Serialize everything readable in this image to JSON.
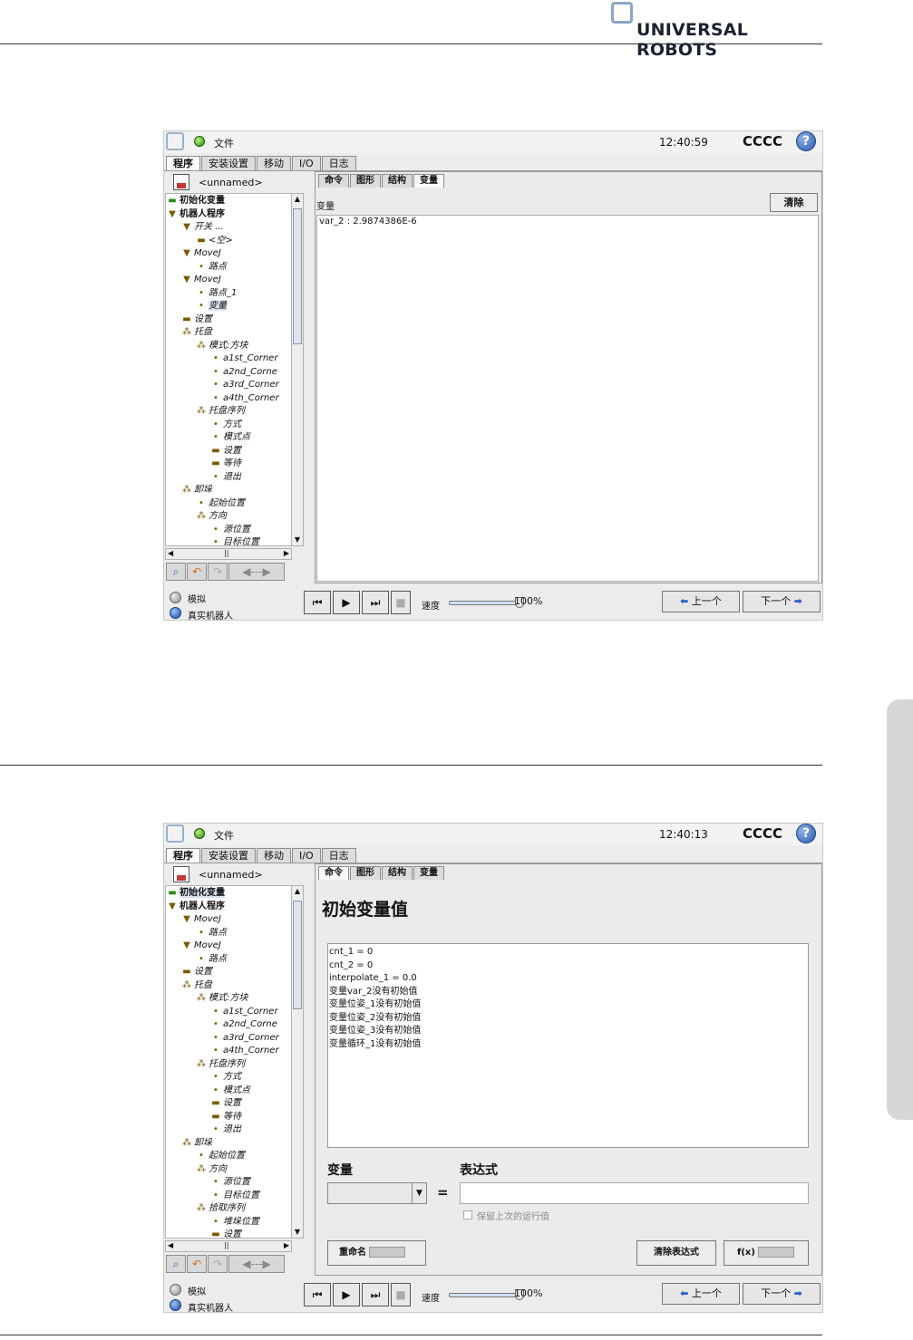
{
  "brand": {
    "logo_text": "UNIVERSAL ROBOTS"
  },
  "screens": [
    {
      "topbar": {
        "file_label": "文件",
        "time": "12:40:59",
        "robot_name": "CCCC",
        "help": "?"
      },
      "main_tabs": [
        "程序",
        "安装设置",
        "移动",
        "I/O",
        "日志"
      ],
      "program_name": "<unnamed>",
      "sub_tabs": [
        "命令",
        "图形",
        "结构",
        "变量"
      ],
      "active_sub_tab": "变量",
      "variables_panel": {
        "heading": "变量",
        "clear_button": "清除",
        "entries": [
          "var_2 : 2.9874386E-6"
        ]
      },
      "tree": [
        {
          "label": "初始化变量",
          "icon": "line-icon",
          "depth": 0
        },
        {
          "label": "机器人程序",
          "icon": "triangle-down-icon",
          "depth": 0
        },
        {
          "label": "开关 ...",
          "icon": "triangle-down-icon",
          "depth": 1
        },
        {
          "label": "<空>",
          "icon": "line-icon",
          "depth": 2
        },
        {
          "label": "MoveJ",
          "icon": "triangle-down-icon",
          "depth": 1
        },
        {
          "label": "路点",
          "icon": "dot-icon",
          "depth": 2
        },
        {
          "label": "MoveJ",
          "icon": "triangle-down-icon",
          "depth": 1
        },
        {
          "label": "路点_1",
          "icon": "dot-icon",
          "depth": 2
        },
        {
          "label": "变量",
          "icon": "dot-icon",
          "depth": 2,
          "selected": true
        },
        {
          "label": "设置",
          "icon": "line-icon",
          "depth": 1
        },
        {
          "label": "托盘",
          "icon": "pattern-icon",
          "depth": 1
        },
        {
          "label": "模式:方块",
          "icon": "pattern-icon",
          "depth": 2
        },
        {
          "label": "a1st_Corner",
          "icon": "dot-icon",
          "depth": 3
        },
        {
          "label": "a2nd_Corne",
          "icon": "dot-icon",
          "depth": 3
        },
        {
          "label": "a3rd_Corner",
          "icon": "dot-icon",
          "depth": 3
        },
        {
          "label": "a4th_Corner",
          "icon": "dot-icon",
          "depth": 3
        },
        {
          "label": "托盘序列",
          "icon": "pattern-icon",
          "depth": 2
        },
        {
          "label": "方式",
          "icon": "dot-icon",
          "depth": 3
        },
        {
          "label": "模式点",
          "icon": "dot-icon",
          "depth": 3
        },
        {
          "label": "设置",
          "icon": "line-icon",
          "depth": 3
        },
        {
          "label": "等待",
          "icon": "line-icon",
          "depth": 3
        },
        {
          "label": "退出",
          "icon": "dot-icon",
          "depth": 3
        },
        {
          "label": "卸垛",
          "icon": "pattern-icon",
          "depth": 1
        },
        {
          "label": "起始位置",
          "icon": "dot-icon",
          "depth": 2
        },
        {
          "label": "方向",
          "icon": "pattern-icon",
          "depth": 2
        },
        {
          "label": "源位置",
          "icon": "dot-icon",
          "depth": 3
        },
        {
          "label": "目标位置",
          "icon": "dot-icon",
          "depth": 3
        }
      ],
      "bottom": {
        "mode_sim": "模拟",
        "mode_real": "真实机器人",
        "speed_label": "速度",
        "speed_value": "100%",
        "speed_fraction": 1.0,
        "prev": "上一个",
        "next": "下一个"
      }
    },
    {
      "topbar": {
        "file_label": "文件",
        "time": "12:40:13",
        "robot_name": "CCCC",
        "help": "?"
      },
      "main_tabs": [
        "程序",
        "安装设置",
        "移动",
        "I/O",
        "日志"
      ],
      "program_name": "<unnamed>",
      "sub_tabs": [
        "命令",
        "图形",
        "结构",
        "变量"
      ],
      "active_sub_tab": "命令",
      "init_panel": {
        "title": "初始变量值",
        "lines": [
          "cnt_1 = 0",
          "cnt_2 = 0",
          "interpolate_1 = 0.0",
          "变量var_2没有初始值",
          "变量位姿_1没有初始值",
          "变量位姿_2没有初始值",
          "变量位姿_3没有初始值",
          "变量循环_1没有初始值"
        ],
        "var_label": "变量",
        "expr_label": "表达式",
        "equals": "=",
        "keep_last": "保留上次的运行值",
        "rename_btn": "重命名",
        "clear_expr_btn": "清除表达式",
        "fx_btn": "f(x)"
      },
      "tree": [
        {
          "label": "初始化变量",
          "icon": "line-icon",
          "depth": 0,
          "selected": true
        },
        {
          "label": "机器人程序",
          "icon": "triangle-down-icon",
          "depth": 0
        },
        {
          "label": "MoveJ",
          "icon": "triangle-down-icon",
          "depth": 1
        },
        {
          "label": "路点",
          "icon": "dot-icon",
          "depth": 2
        },
        {
          "label": "MoveJ",
          "icon": "triangle-down-icon",
          "depth": 1
        },
        {
          "label": "路点",
          "icon": "dot-icon",
          "depth": 2
        },
        {
          "label": "设置",
          "icon": "line-icon",
          "depth": 1
        },
        {
          "label": "托盘",
          "icon": "pattern-icon",
          "depth": 1
        },
        {
          "label": "模式:方块",
          "icon": "pattern-icon",
          "depth": 2
        },
        {
          "label": "a1st_Corner",
          "icon": "dot-icon",
          "depth": 3
        },
        {
          "label": "a2nd_Corne",
          "icon": "dot-icon",
          "depth": 3
        },
        {
          "label": "a3rd_Corner",
          "icon": "dot-icon",
          "depth": 3
        },
        {
          "label": "a4th_Corner",
          "icon": "dot-icon",
          "depth": 3
        },
        {
          "label": "托盘序列",
          "icon": "pattern-icon",
          "depth": 2
        },
        {
          "label": "方式",
          "icon": "dot-icon",
          "depth": 3
        },
        {
          "label": "模式点",
          "icon": "dot-icon",
          "depth": 3
        },
        {
          "label": "设置",
          "icon": "line-icon",
          "depth": 3
        },
        {
          "label": "等待",
          "icon": "line-icon",
          "depth": 3
        },
        {
          "label": "退出",
          "icon": "dot-icon",
          "depth": 3
        },
        {
          "label": "卸垛",
          "icon": "pattern-icon",
          "depth": 1
        },
        {
          "label": "起始位置",
          "icon": "dot-icon",
          "depth": 2
        },
        {
          "label": "方向",
          "icon": "pattern-icon",
          "depth": 2
        },
        {
          "label": "源位置",
          "icon": "dot-icon",
          "depth": 3
        },
        {
          "label": "目标位置",
          "icon": "dot-icon",
          "depth": 3
        },
        {
          "label": "拾取序列",
          "icon": "pattern-icon",
          "depth": 2
        },
        {
          "label": "堆垛位置",
          "icon": "dot-icon",
          "depth": 3
        },
        {
          "label": "设置",
          "icon": "line-icon",
          "depth": 3
        }
      ],
      "bottom": {
        "mode_sim": "模拟",
        "mode_real": "真实机器人",
        "speed_label": "速度",
        "speed_value": "100%",
        "speed_fraction": 1.0,
        "prev": "上一个",
        "next": "下一个"
      }
    }
  ]
}
